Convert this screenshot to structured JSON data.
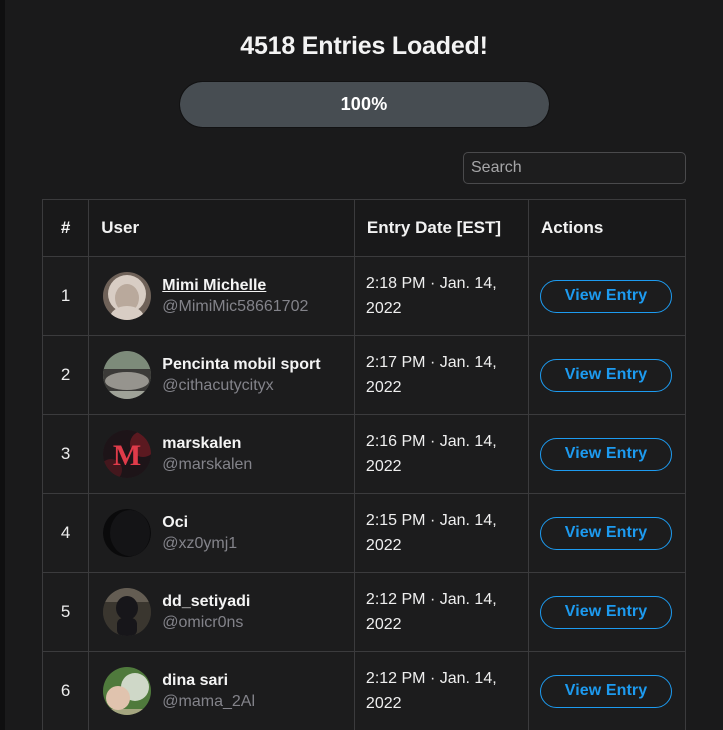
{
  "header": {
    "status_title": "4518 Entries Loaded!",
    "progress": {
      "label": "100%",
      "percent": 100,
      "fill_color": "#474d52",
      "track_color": "#161617"
    }
  },
  "search": {
    "placeholder": "Search",
    "value": ""
  },
  "table": {
    "columns": [
      "#",
      "User",
      "Entry Date [EST]",
      "Actions"
    ],
    "action_label": "View Entry",
    "accent_color": "#1d9bf0",
    "rows": [
      {
        "num": "1",
        "name": "Mimi Michelle",
        "handle": "@MimiMic58661702",
        "name_underlined": true,
        "date": "2:18 PM · Jan. 14, 2022",
        "action": "View Entry",
        "avatar": "portrait-elderly-woman",
        "avatar_colors": [
          "#b9a99c",
          "#6f6259",
          "#d8cdc4"
        ]
      },
      {
        "num": "2",
        "name": "Pencinta mobil sport",
        "handle": "@cithacutycityx",
        "name_underlined": false,
        "date": "2:17 PM · Jan. 14, 2022",
        "action": "View Entry",
        "avatar": "photo-sports-car",
        "avatar_colors": [
          "#7d8b7a",
          "#3b3a38",
          "#b6b3ab"
        ]
      },
      {
        "num": "3",
        "name": "marskalen",
        "handle": "@marskalen",
        "name_underlined": false,
        "date": "2:16 PM · Jan. 14, 2022",
        "action": "View Entry",
        "avatar": "logo-red-letter-m",
        "avatar_colors": [
          "#1d1418",
          "#e03b4a",
          "#8e1d28"
        ]
      },
      {
        "num": "4",
        "name": "Oci",
        "handle": "@xz0ymj1",
        "name_underlined": false,
        "date": "2:15 PM · Jan. 14, 2022",
        "action": "View Entry",
        "avatar": "photo-dark-blank",
        "avatar_colors": [
          "#0a0a0b",
          "#141416",
          "#050506"
        ]
      },
      {
        "num": "5",
        "name": "dd_setiyadi",
        "handle": "@omicr0ns",
        "name_underlined": false,
        "date": "2:12 PM · Jan. 14, 2022",
        "action": "View Entry",
        "avatar": "photo-person-mask",
        "avatar_colors": [
          "#3a362f",
          "#17161a",
          "#9a8f80"
        ]
      },
      {
        "num": "6",
        "name": "dina sari",
        "handle": "@mama_2Al",
        "name_underlined": false,
        "date": "2:12 PM · Jan. 14, 2022",
        "action": "View Entry",
        "avatar": "photo-woman-and-baby",
        "avatar_colors": [
          "#4f7a3c",
          "#e0c3ae",
          "#cfd8c8"
        ]
      }
    ]
  }
}
